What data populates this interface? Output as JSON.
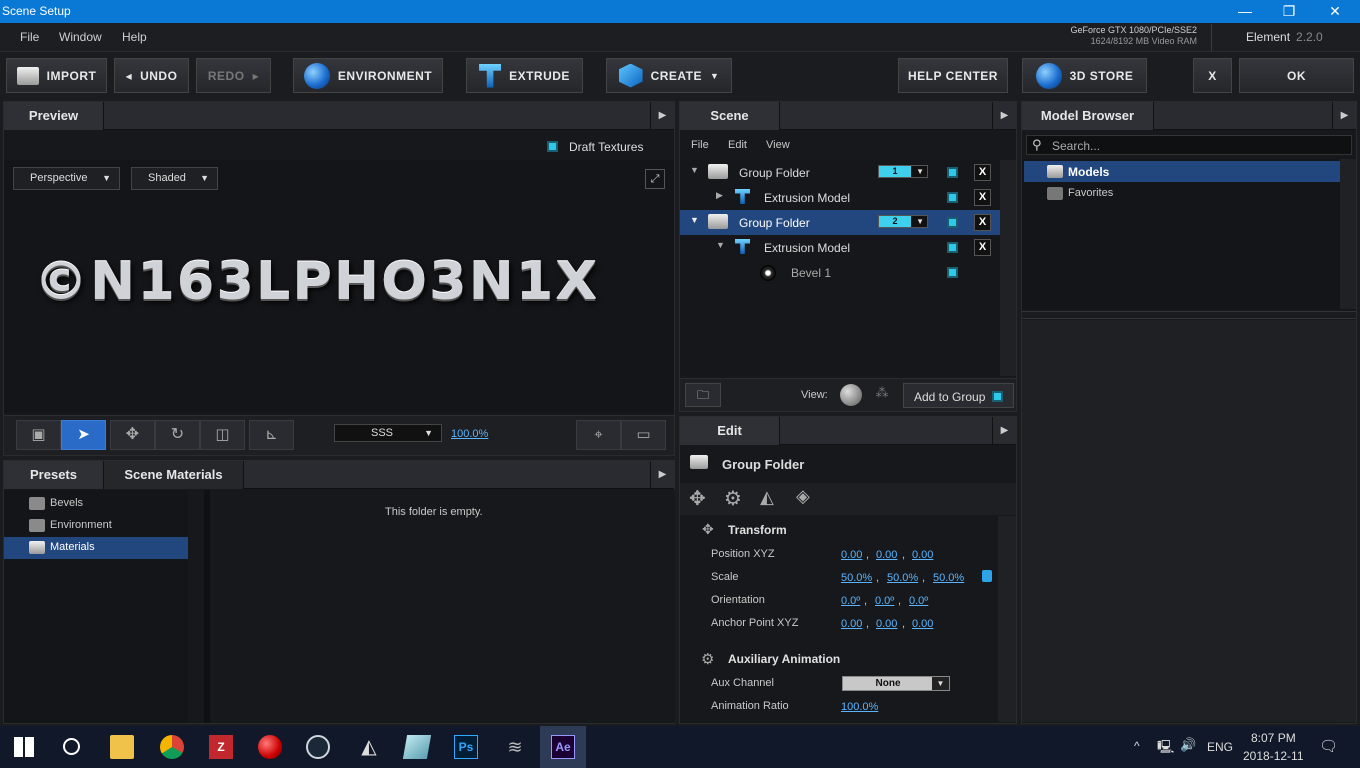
{
  "window": {
    "title": "Scene Setup"
  },
  "menu": {
    "items": [
      "File",
      "Window",
      "Help"
    ]
  },
  "gpu": {
    "line1": "GeForce GTX 1080/PCIe/SSE2",
    "line2": "1624/8192 MB Video RAM"
  },
  "version": {
    "name": "Element",
    "number": "2.2.0"
  },
  "toolbar": {
    "import": "IMPORT",
    "undo": "UNDO",
    "redo": "REDO",
    "environment": "ENVIRONMENT",
    "extrude": "EXTRUDE",
    "create": "CREATE",
    "help": "HELP CENTER",
    "store": "3D STORE",
    "close": "X",
    "ok": "OK"
  },
  "preview": {
    "tab": "Preview",
    "draft": "Draft Textures",
    "view_mode": "Perspective",
    "shading": "Shaded",
    "text": "©N163LPHO3N1X",
    "sss": "SSS",
    "zoom": "100.0%"
  },
  "scene": {
    "tab": "Scene",
    "menu": [
      "File",
      "Edit",
      "View"
    ],
    "rows": [
      {
        "label": "Group Folder",
        "badge": "1"
      },
      {
        "label": "Extrusion Model"
      },
      {
        "label": "Group Folder",
        "badge": "2"
      },
      {
        "label": "Extrusion Model"
      },
      {
        "label": "Bevel 1"
      }
    ],
    "view_label": "View:",
    "add_group": "Add to Group"
  },
  "model_browser": {
    "tab": "Model Browser",
    "search": "Search...",
    "items": [
      "Models",
      "Favorites"
    ]
  },
  "presets": {
    "tabs": [
      "Presets",
      "Scene Materials"
    ],
    "items": [
      "Bevels",
      "Environment",
      "Materials"
    ],
    "empty": "This folder is empty."
  },
  "edit": {
    "tab": "Edit",
    "title": "Group Folder",
    "transform": "Transform",
    "fields": [
      {
        "label": "Position XYZ",
        "v": [
          "0.00",
          "0.00",
          "0.00"
        ]
      },
      {
        "label": "Scale",
        "v": [
          "50.0%",
          "50.0%",
          "50.0%"
        ]
      },
      {
        "label": "Orientation",
        "v": [
          "0.0º",
          "0.0º",
          "0.0º"
        ]
      },
      {
        "label": "Anchor Point XYZ",
        "v": [
          "0.00",
          "0.00",
          "0.00"
        ]
      }
    ],
    "aux": "Auxiliary Animation",
    "aux_channel": "Aux Channel",
    "aux_value": "None",
    "anim_ratio": "Animation Ratio",
    "anim_value": "100.0%"
  },
  "taskbar": {
    "lang": "ENG",
    "time": "8:07 PM",
    "date": "2018-12-11"
  }
}
